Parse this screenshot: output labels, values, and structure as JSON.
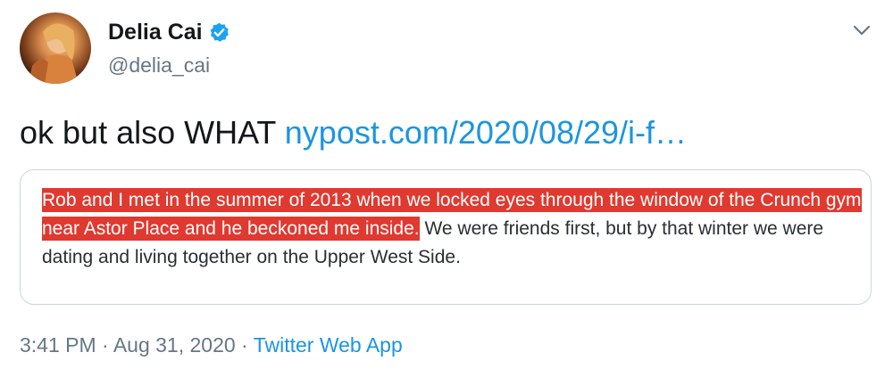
{
  "user": {
    "display_name": "Delia Cai",
    "handle": "@delia_cai",
    "verified": true
  },
  "tweet": {
    "text": "ok but also WHAT ",
    "link": "nypost.com/2020/08/29/i-f…"
  },
  "quote": {
    "highlighted": "Rob and I met in the summer of 2013 when we locked eyes through the window of the Crunch gym near Astor Place and he beckoned me inside.",
    "rest": " We were friends first, but by that winter we were dating and living together on the Upper West Side."
  },
  "meta": {
    "time": "3:41 PM",
    "separator": " · ",
    "date": "Aug 31, 2020",
    "source": "Twitter Web App"
  },
  "icons": {
    "verified": "verified-badge-icon",
    "menu": "chevron-down-icon"
  },
  "colors": {
    "link": "#1b95e0",
    "highlight": "#e0392f",
    "secondary_text": "#657786"
  }
}
